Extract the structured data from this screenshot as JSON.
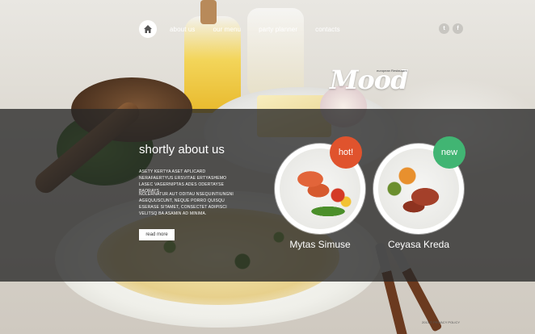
{
  "nav": {
    "items": [
      {
        "label": "about us"
      },
      {
        "label": "our menu"
      },
      {
        "label": "party planner"
      },
      {
        "label": "contacts"
      }
    ]
  },
  "social": {
    "twitter_glyph": "t",
    "facebook_glyph": "f"
  },
  "logo": {
    "name": "Mood",
    "tagline": "european Restaurant"
  },
  "about": {
    "title": "shortly about us",
    "paragraph1": "ASETY KERTYA ASET APLICARD NERAFAERTYUS ERSVITAE ERTYASHEMO LASEC VAGERNIPTAS ADES ODERTAYSE BAORAYS",
    "paragraph2": "NOLERNATUR AUT ODITAU NSEQUINTIUNGNI AGEQUUSCUNT, NEQUE PORRO QUISQU ESERASE SITAMET, CONSECTET ADIPISCI VELITSQ BA ASAMIN AD MINIMA.",
    "read_more": "read more"
  },
  "dishes": [
    {
      "name": "Mytas Simuse",
      "badge": "hot!",
      "badge_color": "#e0532d"
    },
    {
      "name": "Ceyasa Kreda",
      "badge": "new",
      "badge_color": "#41b573"
    }
  ],
  "footer": {
    "copyright": "2013 ©",
    "privacy": "PRIVACY POLICY"
  }
}
